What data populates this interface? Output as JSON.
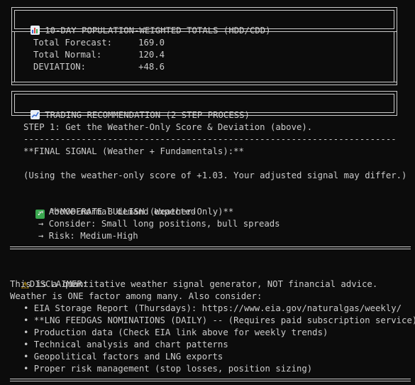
{
  "colors": {
    "background": "#0c0c0c",
    "text": "#cccccc",
    "check_green": "#3aa84f",
    "warning_yellow": "#f2b90f"
  },
  "section1": {
    "icon": "bar-chart-icon",
    "title": "10-DAY POPULATION-WEIGHTED TOTALS (HDD/CDD)",
    "rows": [
      "Total Forecast:     169.0",
      "Total Normal:       120.4",
      "DEVIATION:          +48.6"
    ]
  },
  "section2": {
    "icon": "trending-up-chart-icon",
    "title": "TRADING RECOMMENDATION (2-STEP PROCESS)",
    "step1": "STEP 1: Get the Weather-Only Score & Deviation (above).",
    "dash_rule": "-----------------------------------------------------------------------",
    "final_signal": "**FINAL SIGNAL (Weather + Fundamentals):**",
    "note": "(Using the weather-only score of +1.03. Your adjusted signal may differ.)",
    "signal_icon": "check-mark-icon",
    "signal": "**MODERATE BULLISH (Weather-Only)**",
    "bullets": [
      "→ Above-normal demand expected",
      "→ Consider: Small long positions, bull spreads",
      "→ Risk: Medium-High"
    ]
  },
  "disclaimer": {
    "icon": "warning-icon",
    "title": "DISCLAIMER:",
    "lines": [
      "This is a quantitative weather signal generator, NOT financial advice.",
      "Weather is ONE factor among many. Also consider:"
    ],
    "items": [
      "• EIA Storage Report (Thursdays): https://www.eia.gov/naturalgas/weekly/",
      "• **LNG FEEDGAS NOMINATIONS (DAILY) -- (Requires paid subscription service)**",
      "• Production data (Check EIA link above for weekly trends)",
      "• Technical analysis and chart patterns",
      "• Geopolitical factors and LNG exports",
      "• Proper risk management (stop losses, position sizing)"
    ]
  }
}
